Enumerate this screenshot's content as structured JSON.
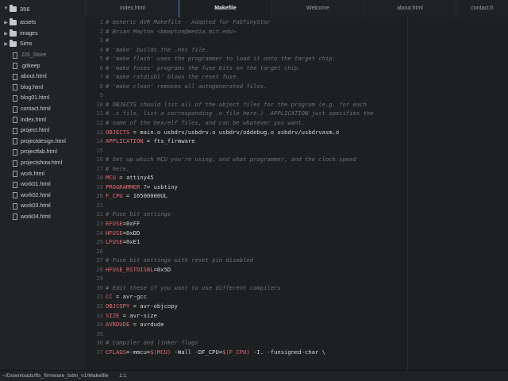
{
  "sidebar": {
    "root": "356",
    "items": [
      {
        "label": "assets",
        "type": "dir"
      },
      {
        "label": "images",
        "type": "dir"
      },
      {
        "label": "Sims",
        "type": "dir"
      },
      {
        "label": ".DS_Store",
        "type": "file",
        "dim": true
      },
      {
        "label": ".gitkeep",
        "type": "file"
      },
      {
        "label": "about.html",
        "type": "file"
      },
      {
        "label": "blog.html",
        "type": "file"
      },
      {
        "label": "blog01.html",
        "type": "file"
      },
      {
        "label": "contact.html",
        "type": "file"
      },
      {
        "label": "index.html",
        "type": "file"
      },
      {
        "label": "project.html",
        "type": "file"
      },
      {
        "label": "projectdesign.html",
        "type": "file"
      },
      {
        "label": "projectfab.html",
        "type": "file"
      },
      {
        "label": "projectshow.html",
        "type": "file"
      },
      {
        "label": "work.html",
        "type": "file"
      },
      {
        "label": "work01.html",
        "type": "file"
      },
      {
        "label": "work02.html",
        "type": "file"
      },
      {
        "label": "work03.html",
        "type": "file"
      },
      {
        "label": "work04.html",
        "type": "file"
      }
    ]
  },
  "tabs": [
    {
      "label": "index.html",
      "active": false
    },
    {
      "label": "Makefile",
      "active": true
    },
    {
      "label": "Welcome",
      "active": false
    },
    {
      "label": "about.html",
      "active": false
    },
    {
      "label": "contact.h",
      "active": false
    }
  ],
  "editor": {
    "lines": [
      {
        "n": "1",
        "type": "comment",
        "text": "# Generic AVR Makefile - Adapted for FabTinyStar"
      },
      {
        "n": "2",
        "type": "comment",
        "text": "# Brian Mayton <bmayton@media.mit.edu>"
      },
      {
        "n": "3",
        "type": "comment",
        "text": "#"
      },
      {
        "n": "4",
        "type": "comment",
        "text": "# 'make' builds the .hex file."
      },
      {
        "n": "5",
        "type": "comment",
        "text": "# 'make flash' uses the programmer to load it onto the target chip."
      },
      {
        "n": "6",
        "type": "comment",
        "text": "# 'make fuses' programs the fuse bits on the target chip."
      },
      {
        "n": "7",
        "type": "comment",
        "text": "# 'make rstdisbl' blows the reset fuse."
      },
      {
        "n": "8",
        "type": "comment",
        "text": "# 'make clean' removes all autogenerated files."
      },
      {
        "n": "9",
        "type": "blank",
        "text": ""
      },
      {
        "n": "10",
        "type": "comment",
        "text": "# OBJECTS should list all of the object files for the program (e.g. for each"
      },
      {
        "n": "11",
        "type": "comment",
        "text": "# .c file, list a corresponding .o file here.)  APPLICATION just specifies the"
      },
      {
        "n": "12",
        "type": "comment",
        "text": "# name of the hex/elf files, and can be whatever you want."
      },
      {
        "n": "13",
        "type": "assign",
        "var": "OBJECTS",
        "rest": " = main.o usbdrv/usbdrv.o usbdrv/oddebug.o usbdrv/usbdrvasm.o"
      },
      {
        "n": "14",
        "type": "assign",
        "var": "APPLICATION",
        "rest": " = fts_firmware"
      },
      {
        "n": "15",
        "type": "blank",
        "text": ""
      },
      {
        "n": "16",
        "type": "comment",
        "text": "# Set up which MCU you're using, and what programmer, and the clock speed"
      },
      {
        "n": "17",
        "type": "comment",
        "text": "# here."
      },
      {
        "n": "18",
        "type": "assign",
        "var": "MCU",
        "rest": " = attiny45"
      },
      {
        "n": "19",
        "type": "assign",
        "var": "PROGRAMMER",
        "rest": " ?= usbtiny"
      },
      {
        "n": "20",
        "type": "assign",
        "var": "F_CPU",
        "rest": " = 16500000UL"
      },
      {
        "n": "21",
        "type": "blank",
        "text": ""
      },
      {
        "n": "22",
        "type": "comment",
        "text": "# Fuse bit settings"
      },
      {
        "n": "23",
        "type": "assign",
        "var": "EFUSE",
        "rest": "=0xFF"
      },
      {
        "n": "24",
        "type": "assign",
        "var": "HFUSE",
        "rest": "=0xDD"
      },
      {
        "n": "25",
        "type": "assign",
        "var": "LFUSE",
        "rest": "=0xE1"
      },
      {
        "n": "26",
        "type": "blank",
        "text": ""
      },
      {
        "n": "27",
        "type": "comment",
        "text": "# Fuse bit settings with reset pin disabled"
      },
      {
        "n": "28",
        "type": "assign",
        "var": "HFUSE_RSTDISBL",
        "rest": "=0x5D"
      },
      {
        "n": "29",
        "type": "blank",
        "text": ""
      },
      {
        "n": "30",
        "type": "comment",
        "text": "# Edit these if you want to use different compilers"
      },
      {
        "n": "31",
        "type": "assign",
        "var": "CC",
        "rest": " = avr-gcc"
      },
      {
        "n": "32",
        "type": "assign",
        "var": "OBJCOPY",
        "rest": " = avr-objcopy"
      },
      {
        "n": "33",
        "type": "assign",
        "var": "SIZE",
        "rest": " = avr-size"
      },
      {
        "n": "34",
        "type": "assign",
        "var": "AVRDUDE",
        "rest": " = avrdude"
      },
      {
        "n": "35",
        "type": "blank",
        "text": ""
      },
      {
        "n": "36",
        "type": "comment",
        "text": "# Compiler and linker flags"
      },
      {
        "n": "37",
        "type": "cflags",
        "parts": [
          {
            "t": "CFLAGS",
            "c": "var"
          },
          {
            "t": "=-mmcu=",
            "c": "plain"
          },
          {
            "t": "$(MCU)",
            "c": "var"
          },
          {
            "t": " -Wall -DF_CPU=",
            "c": "plain"
          },
          {
            "t": "$(F_CPU)",
            "c": "var"
          },
          {
            "t": " -I. -funsigned-char \\",
            "c": "plain"
          }
        ]
      }
    ]
  },
  "status": {
    "path": "~/Downloads/fts_firmware_bdm_v1/Makefile",
    "cursor": "1:1"
  },
  "colors": {
    "background": "#1d1f21",
    "variable": "#e06c75",
    "comment": "#6c727a",
    "active_tab_accent": "#4a8dd8"
  }
}
